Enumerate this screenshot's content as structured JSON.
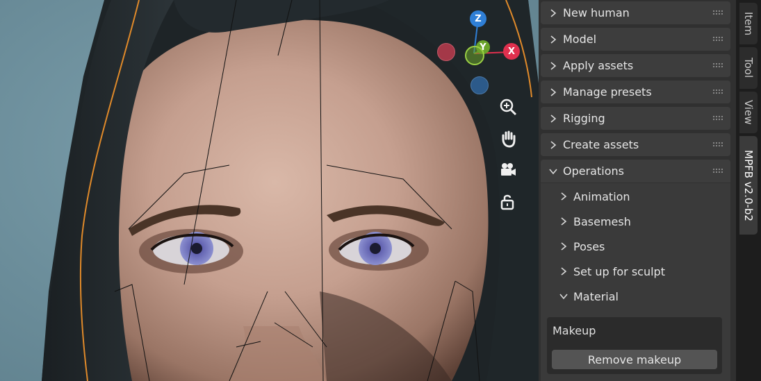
{
  "gizmo": {
    "z_label": "Z",
    "y_label": "Y",
    "x_label": "X",
    "colors": {
      "x": "#e0304e",
      "y": "#6aa32a",
      "z": "#2f7fd6",
      "neg_x": "#a43848",
      "neg_z": "#2c5a8a"
    }
  },
  "viewport_tools": [
    "zoom-icon",
    "pan-hand-icon",
    "camera-icon",
    "lock-icon"
  ],
  "panel": {
    "sections": [
      {
        "label": "New human",
        "expanded": false
      },
      {
        "label": "Model",
        "expanded": false
      },
      {
        "label": "Apply assets",
        "expanded": false
      },
      {
        "label": "Manage presets",
        "expanded": false
      },
      {
        "label": "Rigging",
        "expanded": false
      },
      {
        "label": "Create assets",
        "expanded": false
      },
      {
        "label": "Operations",
        "expanded": true
      }
    ],
    "operations": [
      {
        "label": "Animation",
        "expanded": false
      },
      {
        "label": "Basemesh",
        "expanded": false
      },
      {
        "label": "Poses",
        "expanded": false
      },
      {
        "label": "Set up for sculpt",
        "expanded": false
      },
      {
        "label": "Material",
        "expanded": true
      }
    ],
    "makeup": {
      "title": "Makeup",
      "button": "Remove makeup"
    }
  },
  "tabs": [
    {
      "label": "Item",
      "active": false
    },
    {
      "label": "Tool",
      "active": false
    },
    {
      "label": "View",
      "active": false
    },
    {
      "label": "MPFB v2.0-b2",
      "active": true
    }
  ]
}
